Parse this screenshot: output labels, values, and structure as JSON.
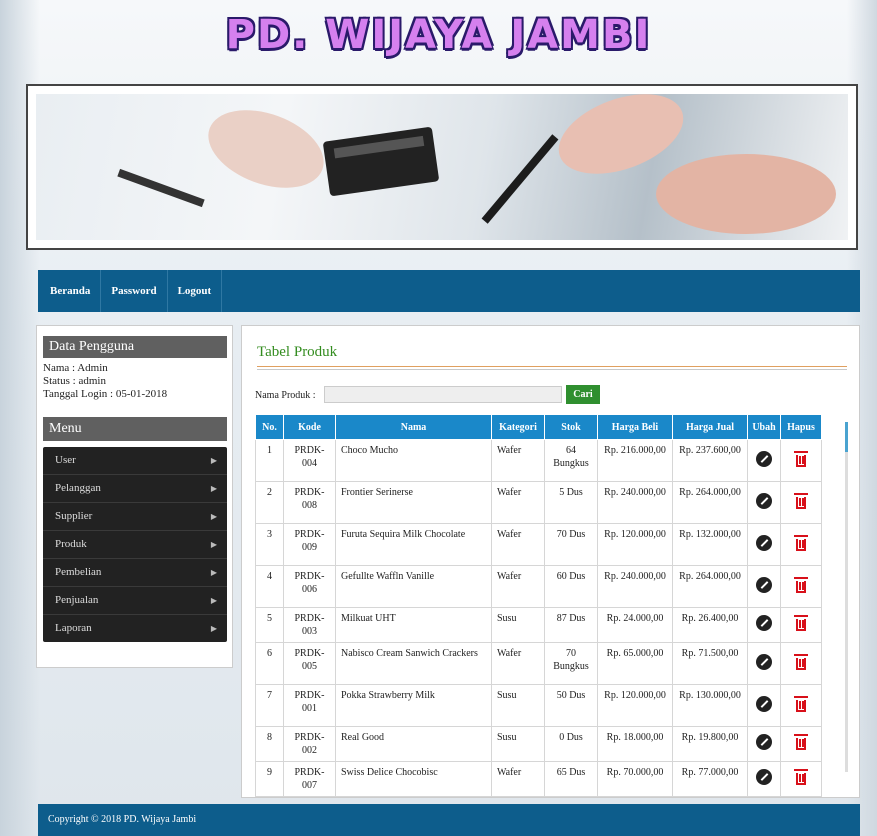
{
  "brand": {
    "logo_text": "PD. WIJAYA JAMBI"
  },
  "nav": {
    "items": [
      "Beranda",
      "Password",
      "Logout"
    ]
  },
  "sidebar": {
    "user_heading": "Data Pengguna",
    "nama": "Nama : Admin",
    "status": "Status : admin",
    "tanggal_login": "Tanggal Login : 05-01-2018",
    "menu_heading": "Menu",
    "menu_items": [
      "User",
      "Pelanggan",
      "Supplier",
      "Produk",
      "Pembelian",
      "Penjualan",
      "Laporan"
    ]
  },
  "main": {
    "title": "Tabel Produk",
    "search_label": "Nama Produk :",
    "search_value": "",
    "search_button": "Cari",
    "columns": [
      "No.",
      "Kode",
      "Nama",
      "Kategori",
      "Stok",
      "Harga Beli",
      "Harga Jual",
      "Ubah",
      "Hapus"
    ],
    "rows": [
      {
        "no": "1",
        "kode": "PRDK-004",
        "nama": "Choco Mucho",
        "kategori": "Wafer",
        "stok": "64 Bungkus",
        "harga_beli": "Rp. 216.000,00",
        "harga_jual": "Rp. 237.600,00"
      },
      {
        "no": "2",
        "kode": "PRDK-008",
        "nama": "Frontier Serinerse",
        "kategori": "Wafer",
        "stok": "5 Dus",
        "harga_beli": "Rp. 240.000,00",
        "harga_jual": "Rp. 264.000,00"
      },
      {
        "no": "3",
        "kode": "PRDK-009",
        "nama": "Furuta Sequira Milk Chocolate",
        "kategori": "Wafer",
        "stok": "70 Dus",
        "harga_beli": "Rp. 120.000,00",
        "harga_jual": "Rp. 132.000,00"
      },
      {
        "no": "4",
        "kode": "PRDK-006",
        "nama": "Gefullte Waffln Vanille",
        "kategori": "Wafer",
        "stok": "60 Dus",
        "harga_beli": "Rp. 240.000,00",
        "harga_jual": "Rp. 264.000,00"
      },
      {
        "no": "5",
        "kode": "PRDK-003",
        "nama": "Milkuat UHT",
        "kategori": "Susu",
        "stok": "87 Dus",
        "harga_beli": "Rp. 24.000,00",
        "harga_jual": "Rp. 26.400,00"
      },
      {
        "no": "6",
        "kode": "PRDK-005",
        "nama": "Nabisco Cream Sanwich Crackers",
        "kategori": "Wafer",
        "stok": "70 Bungkus",
        "harga_beli": "Rp. 65.000,00",
        "harga_jual": "Rp. 71.500,00"
      },
      {
        "no": "7",
        "kode": "PRDK-001",
        "nama": "Pokka Strawberry Milk",
        "kategori": "Susu",
        "stok": "50 Dus",
        "harga_beli": "Rp. 120.000,00",
        "harga_jual": "Rp. 130.000,00"
      },
      {
        "no": "8",
        "kode": "PRDK-002",
        "nama": "Real Good",
        "kategori": "Susu",
        "stok": "0 Dus",
        "harga_beli": "Rp. 18.000,00",
        "harga_jual": "Rp. 19.800,00"
      },
      {
        "no": "9",
        "kode": "PRDK-007",
        "nama": "Swiss Delice Chocobisc",
        "kategori": "Wafer",
        "stok": "65 Dus",
        "harga_beli": "Rp. 70.000,00",
        "harga_jual": "Rp. 77.000,00"
      }
    ]
  },
  "footer": {
    "text": "Copyright © 2018 PD. Wijaya Jambi"
  }
}
